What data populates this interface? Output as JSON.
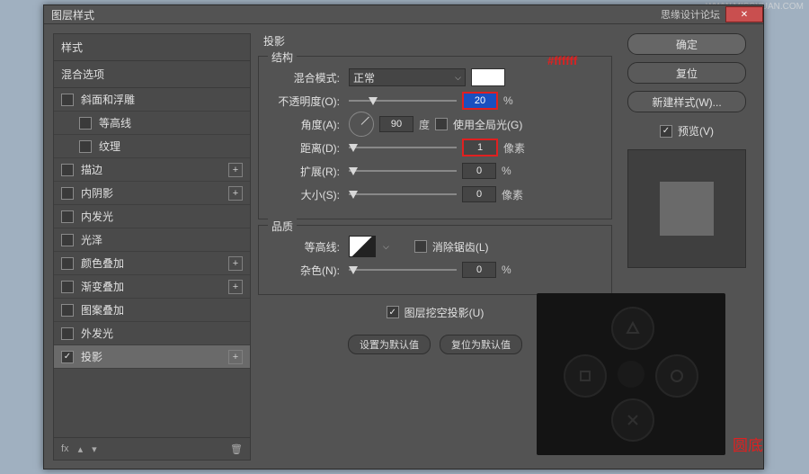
{
  "title": "图层样式",
  "credits": "思缘设计论坛",
  "watermark": "WWW.MISSYUAN.COM",
  "left": {
    "header": "样式",
    "sub": "混合选项",
    "items": [
      {
        "label": "斜面和浮雕",
        "checked": false,
        "indent": false,
        "plus": false
      },
      {
        "label": "等高线",
        "checked": false,
        "indent": true,
        "plus": false
      },
      {
        "label": "纹理",
        "checked": false,
        "indent": true,
        "plus": false
      },
      {
        "label": "描边",
        "checked": false,
        "indent": false,
        "plus": true
      },
      {
        "label": "内阴影",
        "checked": false,
        "indent": false,
        "plus": true
      },
      {
        "label": "内发光",
        "checked": false,
        "indent": false,
        "plus": false
      },
      {
        "label": "光泽",
        "checked": false,
        "indent": false,
        "plus": false
      },
      {
        "label": "颜色叠加",
        "checked": false,
        "indent": false,
        "plus": true
      },
      {
        "label": "渐变叠加",
        "checked": false,
        "indent": false,
        "plus": true
      },
      {
        "label": "图案叠加",
        "checked": false,
        "indent": false,
        "plus": false
      },
      {
        "label": "外发光",
        "checked": false,
        "indent": false,
        "plus": false
      },
      {
        "label": "投影",
        "checked": true,
        "indent": false,
        "plus": true,
        "selected": true
      }
    ],
    "footer_fx": "fx"
  },
  "center": {
    "title": "投影",
    "structure": {
      "label": "结构",
      "blend_label": "混合模式:",
      "blend_value": "正常",
      "swatch_color": "#ffffff",
      "opacity_label": "不透明度(O):",
      "opacity_value": "20",
      "opacity_unit": "%",
      "angle_label": "角度(A):",
      "angle_value": "90",
      "angle_unit": "度",
      "global_light_label": "使用全局光(G)",
      "global_light_checked": false,
      "distance_label": "距离(D):",
      "distance_value": "1",
      "distance_unit": "像素",
      "spread_label": "扩展(R):",
      "spread_value": "0",
      "spread_unit": "%",
      "size_label": "大小(S):",
      "size_value": "0",
      "size_unit": "像素"
    },
    "quality": {
      "label": "品质",
      "contour_label": "等高线:",
      "antialias_label": "消除锯齿(L)",
      "antialias_checked": false,
      "noise_label": "杂色(N):",
      "noise_value": "0",
      "noise_unit": "%"
    },
    "knockout_label": "图层挖空投影(U)",
    "knockout_checked": true,
    "btn_default": "设置为默认值",
    "btn_reset": "复位为默认值"
  },
  "right": {
    "ok": "确定",
    "cancel": "复位",
    "newstyle": "新建样式(W)...",
    "preview_label": "预览(V)",
    "preview_checked": true
  },
  "annotations": {
    "hex": "#ffffff",
    "round_bottom": "圆底"
  }
}
